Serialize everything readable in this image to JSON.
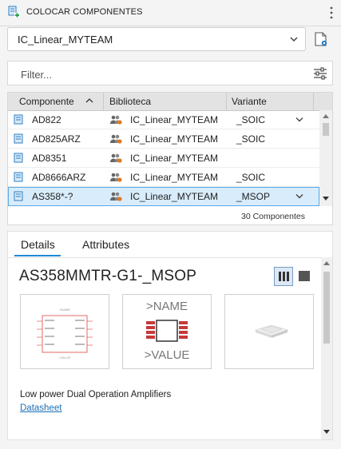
{
  "panel": {
    "title": "COLOCAR COMPONENTES"
  },
  "library_select": {
    "value": "IC_Linear_MYTEAM"
  },
  "filter": {
    "placeholder": "Filter..."
  },
  "table": {
    "columns": [
      "Componente",
      "Biblioteca",
      "Variante"
    ],
    "rows": [
      {
        "component": "AD822",
        "library": "IC_Linear_MYTEAM",
        "variant": "_SOIC",
        "has_dropdown": true,
        "selected": false
      },
      {
        "component": "AD825ARZ",
        "library": "IC_Linear_MYTEAM",
        "variant": "_SOIC",
        "has_dropdown": false,
        "selected": false
      },
      {
        "component": "AD8351",
        "library": "IC_Linear_MYTEAM",
        "variant": "",
        "has_dropdown": false,
        "selected": false
      },
      {
        "component": "AD8666ARZ",
        "library": "IC_Linear_MYTEAM",
        "variant": "_SOIC",
        "has_dropdown": false,
        "selected": false
      },
      {
        "component": "AS358*-?",
        "library": "IC_Linear_MYTEAM",
        "variant": "_MSOP",
        "has_dropdown": true,
        "selected": true
      }
    ],
    "count_label": "30 Componentes"
  },
  "details": {
    "tabs": [
      "Details",
      "Attributes"
    ],
    "active_tab": "Details",
    "part_name": "AS358MMTR-G1-_MSOP",
    "package_preview": {
      "name_text": ">NAME",
      "value_text": ">VALUE"
    },
    "description": "Low power Dual Operation Amplifiers",
    "datasheet_link": "Datasheet"
  },
  "colors": {
    "accent": "#1e8ad6",
    "selected_row": "#d9ecfb",
    "link": "#1e6fb7",
    "pad": "#c43a3a"
  }
}
